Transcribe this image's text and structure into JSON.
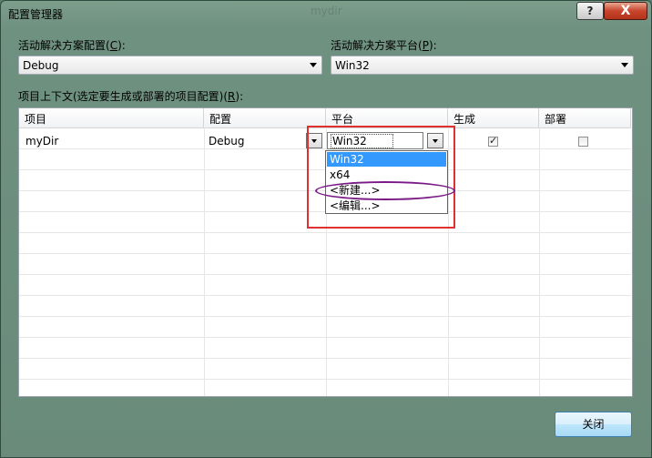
{
  "window": {
    "title": "配置管理器",
    "faded_title": "mydir"
  },
  "titlebar": {
    "help_glyph": "?",
    "close_glyph": "X"
  },
  "active_config": {
    "label_prefix": "活动解决方案配置(",
    "label_key": "C",
    "label_suffix": "):",
    "value": "Debug"
  },
  "active_platform": {
    "label_prefix": "活动解决方案平台(",
    "label_key": "P",
    "label_suffix": "):",
    "value": "Win32"
  },
  "project_contexts": {
    "label_prefix": "项目上下文(选定要生成或部署的项目配置)(",
    "label_key": "R",
    "label_suffix": "):"
  },
  "grid": {
    "columns": [
      "项目",
      "配置",
      "平台",
      "生成",
      "部署"
    ],
    "rows": [
      {
        "project": "myDir",
        "config": "Debug",
        "platform": "Win32",
        "build": true,
        "deploy": false
      }
    ]
  },
  "platform_dropdown": {
    "options": [
      "Win32",
      "x64",
      "<新建...>",
      "<编辑...>"
    ],
    "selected_index": 0
  },
  "footer": {
    "close_label": "关闭"
  }
}
